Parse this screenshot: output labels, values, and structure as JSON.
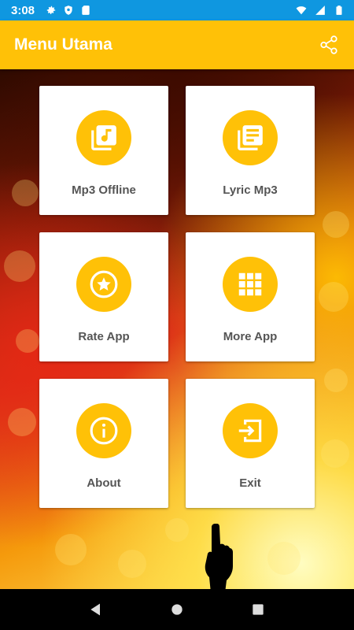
{
  "status_bar": {
    "time": "3:08",
    "left_icons": [
      "settings-icon",
      "shield-icon",
      "sd-card-icon"
    ],
    "right_icons": [
      "wifi-icon",
      "signal-icon",
      "battery-icon"
    ],
    "color": "#0F97E0"
  },
  "app_bar": {
    "title": "Menu Utama",
    "share_icon": "share-icon",
    "color": "#FFC107"
  },
  "menu": {
    "items": [
      {
        "label": "Mp3 Offline",
        "icon": "music-library-icon"
      },
      {
        "label": "Lyric Mp3",
        "icon": "lyrics-list-icon"
      },
      {
        "label": "Rate App",
        "icon": "star-icon"
      },
      {
        "label": "More App",
        "icon": "apps-grid-icon"
      },
      {
        "label": "About",
        "icon": "info-icon"
      },
      {
        "label": "Exit",
        "icon": "exit-icon"
      }
    ],
    "accent": "#FFC107",
    "label_color": "#555555"
  },
  "nav_bar": {
    "buttons": [
      "back-icon",
      "home-icon",
      "recents-icon"
    ]
  }
}
